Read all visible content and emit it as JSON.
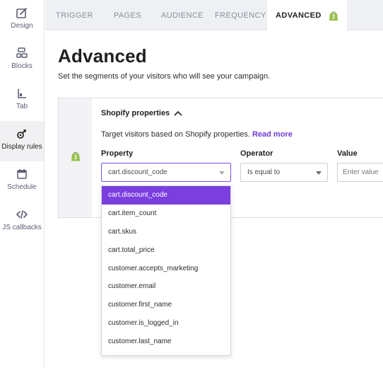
{
  "sidebar": {
    "items": [
      {
        "label": "Design",
        "icon": "design-icon",
        "active": false
      },
      {
        "label": "Blocks",
        "icon": "blocks-icon",
        "active": false
      },
      {
        "label": "Tab",
        "icon": "tab-icon",
        "active": false
      },
      {
        "label": "Display rules",
        "icon": "display-rules-icon",
        "active": true
      },
      {
        "label": "Schedule",
        "icon": "calendar-icon",
        "active": false
      },
      {
        "label": "JS callbacks",
        "icon": "code-icon",
        "active": false
      }
    ]
  },
  "tabs": [
    {
      "label": "TRIGGER",
      "active": false
    },
    {
      "label": "PAGES",
      "active": false
    },
    {
      "label": "AUDIENCE",
      "active": false
    },
    {
      "label": "FREQUENCY",
      "active": false
    },
    {
      "label": "ADVANCED",
      "active": true,
      "icon": "shopify-icon"
    }
  ],
  "page": {
    "title": "Advanced",
    "subtitle": "Set the segments of your visitors who will see your campaign."
  },
  "shopify_section": {
    "heading": "Shopify properties",
    "description": "Target visitors based on Shopify properties.",
    "read_more": "Read more",
    "property_label": "Property",
    "operator_label": "Operator",
    "value_label": "Value",
    "property_value": "cart.discount_code",
    "operator_value": "Is equal to",
    "value_placeholder": "Enter value"
  },
  "dropdown": {
    "options": [
      "cart.discount_code",
      "cart.item_count",
      "cart.skus",
      "cart.total_price",
      "customer.accepts_marketing",
      "customer.email",
      "customer.first_name",
      "customer.is_logged_in",
      "customer.last_name"
    ],
    "selected_index": 0
  },
  "colors": {
    "accent": "#7b3fe0",
    "shopify_green": "#95bf47",
    "link": "#6f3ad6"
  }
}
